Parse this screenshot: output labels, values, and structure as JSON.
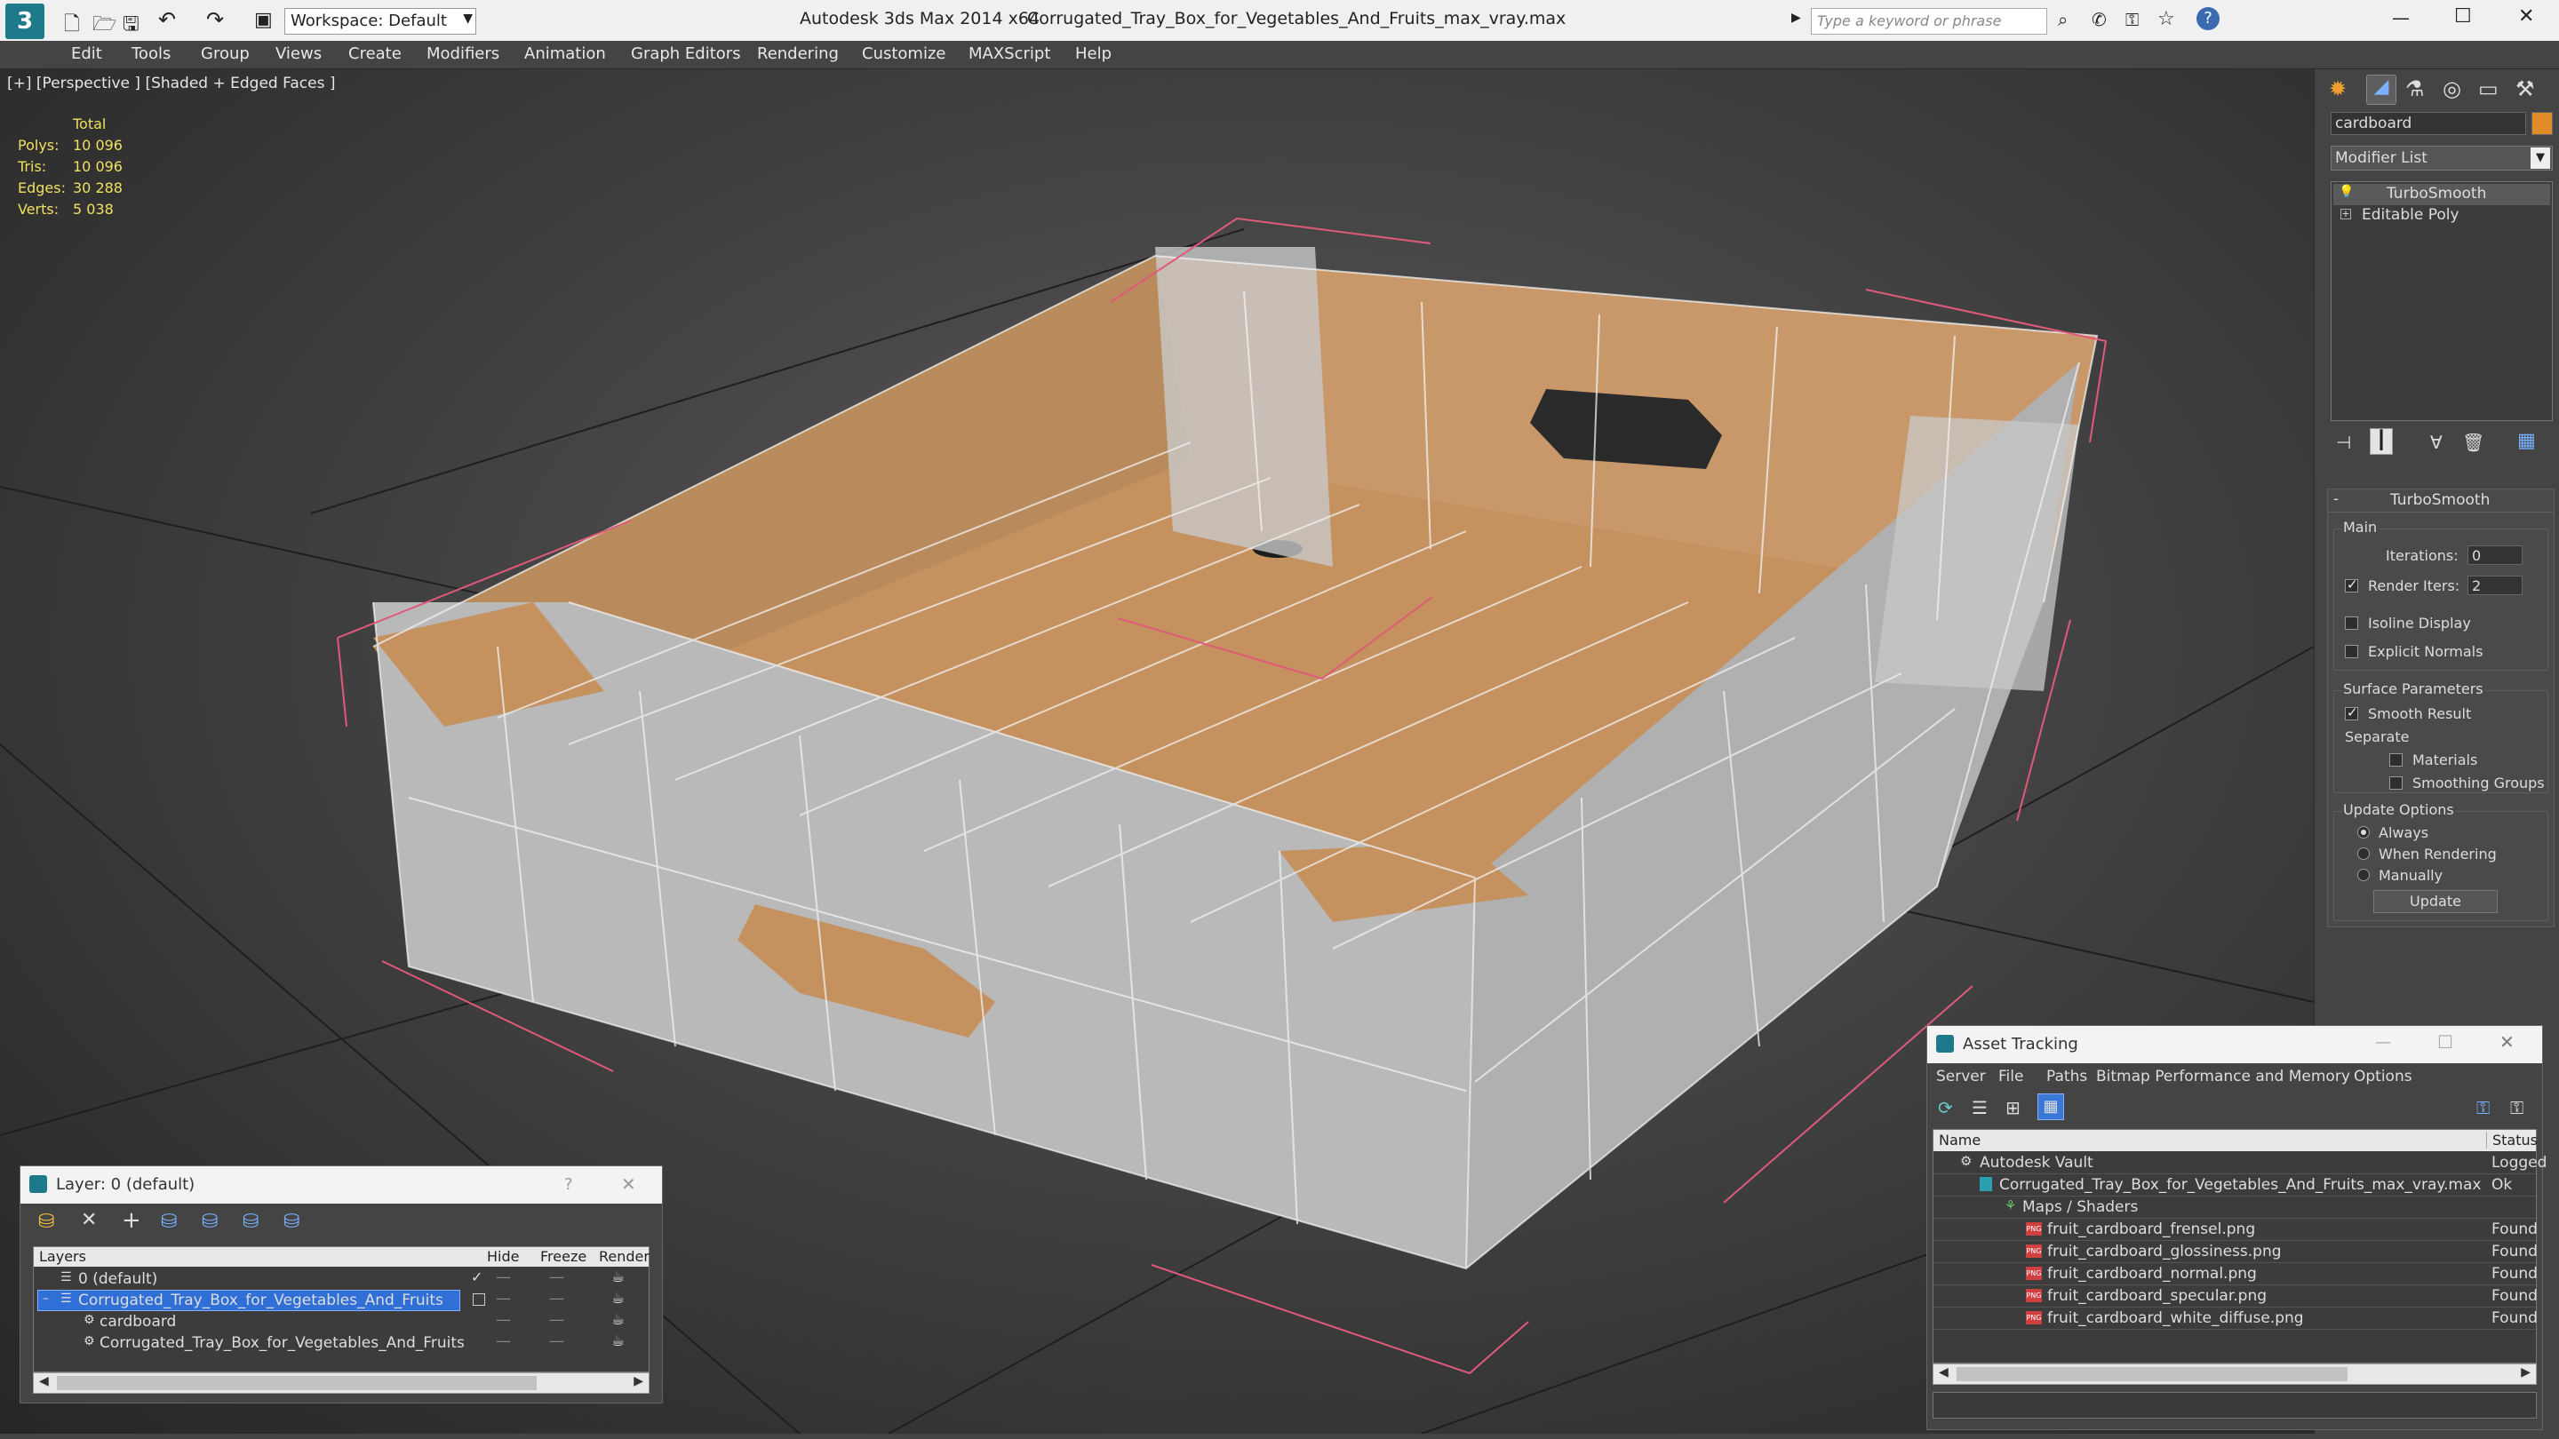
{
  "titlebar": {
    "workspace": "Workspace: Default",
    "app_title": "Autodesk 3ds Max 2014 x64",
    "file_title": "Corrugated_Tray_Box_for_Vegetables_And_Fruits_max_vray.max",
    "search_placeholder": "Type a keyword or phrase",
    "minimize": "—",
    "maximize": "☐",
    "close": "✕"
  },
  "menu": [
    "Edit",
    "Tools",
    "Group",
    "Views",
    "Create",
    "Modifiers",
    "Animation",
    "Graph Editors",
    "Rendering",
    "Customize",
    "MAXScript",
    "Help"
  ],
  "viewport": {
    "label": "[+] [Perspective ] [Shaded + Edged Faces ]",
    "stats_header": "Total",
    "stats": [
      {
        "label": "Polys:",
        "value": "10 096"
      },
      {
        "label": "Tris:",
        "value": "10 096"
      },
      {
        "label": "Edges:",
        "value": "30 288"
      },
      {
        "label": "Verts:",
        "value": "5 038"
      }
    ]
  },
  "cmdpanel": {
    "object_name": "cardboard",
    "modifier_list": "Modifier List",
    "stack": [
      "TurboSmooth",
      "Editable Poly"
    ],
    "rollout_title": "TurboSmooth",
    "main_group": "Main",
    "iterations_label": "Iterations:",
    "iterations_value": "0",
    "render_iters_label": "Render Iters:",
    "render_iters_value": "2",
    "isoline": "Isoline Display",
    "explicit_normals": "Explicit Normals",
    "surface_group": "Surface Parameters",
    "smooth_result": "Smooth Result",
    "separate": "Separate",
    "materials": "Materials",
    "smoothing_groups": "Smoothing Groups",
    "update_group": "Update Options",
    "always": "Always",
    "when_rendering": "When Rendering",
    "manually": "Manually",
    "update_button": "Update"
  },
  "layer_window": {
    "title": "Layer: 0 (default)",
    "help": "?",
    "close": "✕",
    "columns": [
      "Layers",
      "Hide",
      "Freeze",
      "Render"
    ],
    "rows": [
      {
        "name": "0 (default)",
        "indent": 0,
        "selected": false
      },
      {
        "name": "Corrugated_Tray_Box_for_Vegetables_And_Fruits",
        "indent": 0,
        "selected": true
      },
      {
        "name": "cardboard",
        "indent": 1,
        "selected": false
      },
      {
        "name": "Corrugated_Tray_Box_for_Vegetables_And_Fruits",
        "indent": 1,
        "selected": false
      }
    ]
  },
  "asset_window": {
    "title": "Asset Tracking",
    "menu": [
      "Server",
      "File",
      "Paths",
      "Bitmap Performance and Memory",
      "Options"
    ],
    "columns": [
      "Name",
      "Status"
    ],
    "rows": [
      {
        "name": "Autodesk Vault",
        "status": "Logged",
        "indent": 0
      },
      {
        "name": "Corrugated_Tray_Box_for_Vegetables_And_Fruits_max_vray.max",
        "status": "Ok",
        "indent": 1
      },
      {
        "name": "Maps / Shaders",
        "status": "",
        "indent": 2
      },
      {
        "name": "fruit_cardboard_frensel.png",
        "status": "Found",
        "indent": 3
      },
      {
        "name": "fruit_cardboard_glossiness.png",
        "status": "Found",
        "indent": 3
      },
      {
        "name": "fruit_cardboard_normal.png",
        "status": "Found",
        "indent": 3
      },
      {
        "name": "fruit_cardboard_specular.png",
        "status": "Found",
        "indent": 3
      },
      {
        "name": "fruit_cardboard_white_diffuse.png",
        "status": "Found",
        "indent": 3
      }
    ]
  },
  "colors": {
    "cardboard_inner": "#c4915f",
    "cardboard_outer": "#b9b9b9",
    "selection_bracket": "#e05a7a",
    "layer_selected": "#2f6fd6"
  }
}
